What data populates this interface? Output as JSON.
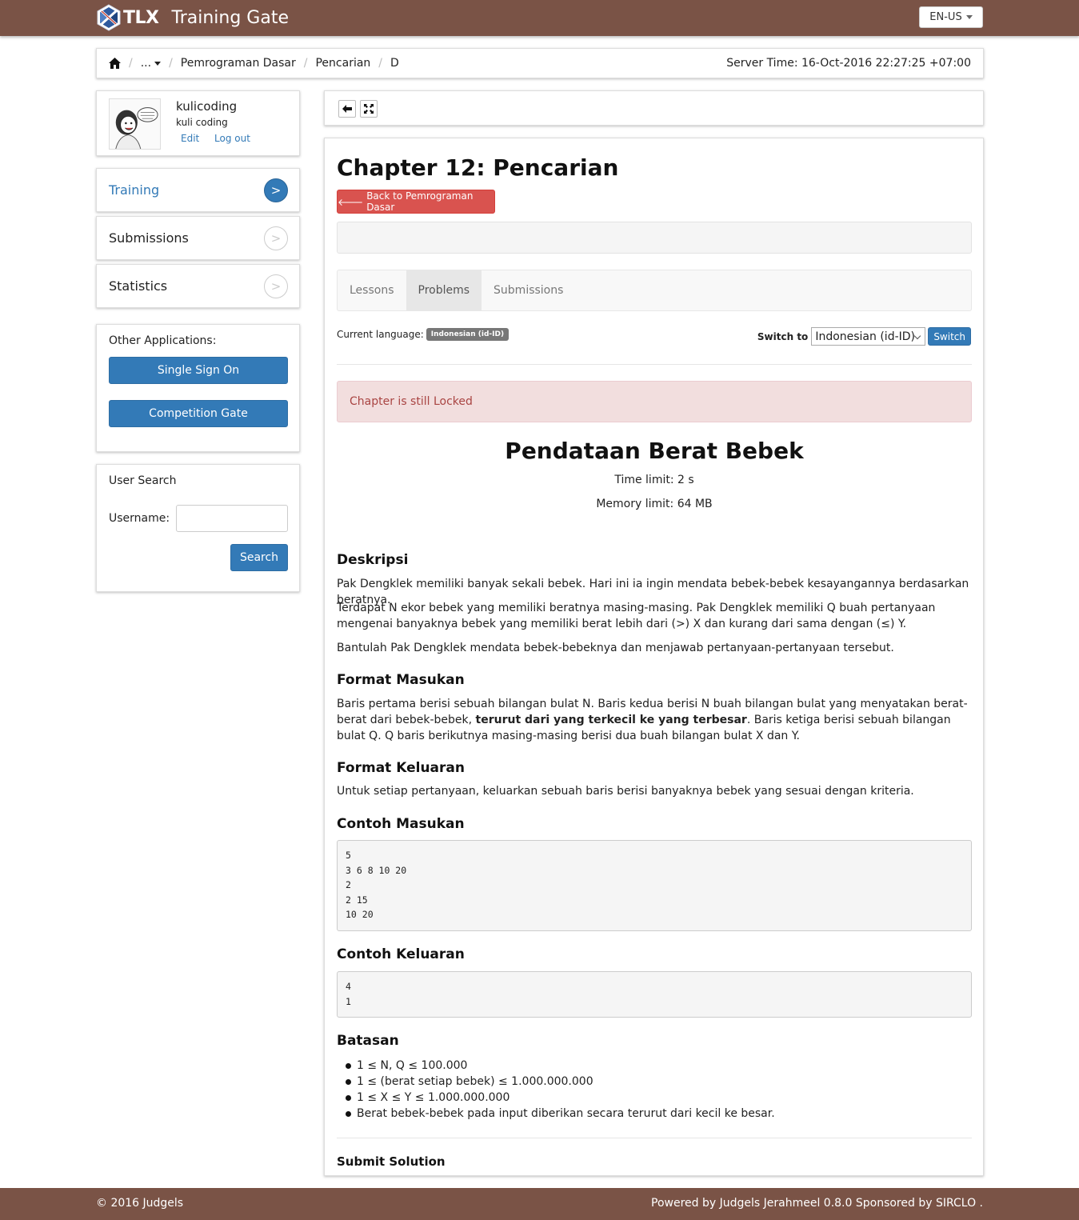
{
  "header": {
    "logo_text": "TLX",
    "app_title": "Training Gate",
    "language": "EN-US"
  },
  "breadcrumb": {
    "items": [
      "...",
      "Pemrograman Dasar",
      "Pencarian",
      "D"
    ],
    "server_time": "Server Time: 16-Oct-2016 22:27:25 +07:00"
  },
  "user": {
    "username": "kulicoding",
    "display_name": "kuli coding",
    "edit_label": "Edit",
    "logout_label": "Log out"
  },
  "sidebar": {
    "nav": [
      {
        "label": "Training",
        "active": true
      },
      {
        "label": "Submissions",
        "active": false
      },
      {
        "label": "Statistics",
        "active": false
      }
    ],
    "nav_arrow": ">",
    "other_apps_title": "Other Applications:",
    "apps": [
      "Single Sign On",
      "Competition Gate"
    ],
    "user_search": {
      "title": "User Search",
      "username_label": "Username:",
      "username_value": "",
      "button": "Search"
    }
  },
  "chapter": {
    "title": "Chapter 12: Pencarian",
    "back_button": "Back to Pemrograman Dasar",
    "tabs": [
      "Lessons",
      "Problems",
      "Submissions"
    ],
    "active_tab": "Problems",
    "current_language_label": "Current language:",
    "current_language": "Indonesian (id-ID)",
    "switch_to_label": "Switch to",
    "switch_select_value": "Indonesian (id-ID)",
    "switch_button": "Switch",
    "alert": "Chapter is still Locked"
  },
  "problem": {
    "title": "Pendataan Berat Bebek",
    "time_limit": "Time limit: 2 s",
    "memory_limit": "Memory limit: 64 MB",
    "sections": {
      "deskripsi_title": "Deskripsi",
      "deskripsi_p1": "Pak Dengklek memiliki banyak sekali bebek. Hari ini ia ingin mendata bebek-bebek kesayangannya berdasarkan beratnya.",
      "deskripsi_p2": "Terdapat N ekor bebek yang memiliki beratnya masing-masing. Pak Dengklek memiliki Q buah pertanyaan mengenai banyaknya bebek yang memiliki berat lebih dari (>) X dan kurang dari sama dengan (≤) Y.",
      "deskripsi_p3": "Bantulah Pak Dengklek mendata bebek-bebeknya dan menjawab pertanyaan-pertanyaan tersebut.",
      "masukan_title": "Format Masukan",
      "masukan_p_before": "Baris pertama berisi sebuah bilangan bulat N. Baris kedua berisi N buah bilangan bulat yang menyatakan berat-berat dari bebek-bebek, ",
      "masukan_p_bold": "terurut dari yang terkecil ke yang terbesar",
      "masukan_p_after": ". Baris ketiga berisi sebuah bilangan bulat Q. Q baris berikutnya masing-masing berisi dua buah bilangan bulat X dan Y.",
      "keluaran_title": "Format Keluaran",
      "keluaran_p": "Untuk setiap pertanyaan, keluarkan sebuah baris berisi banyaknya bebek yang sesuai dengan kriteria.",
      "contoh_masukan_title": "Contoh Masukan",
      "contoh_masukan": [
        "5",
        "3 6 8 10 20",
        "2",
        "2 15",
        "10 20"
      ],
      "contoh_keluaran_title": "Contoh Keluaran",
      "contoh_keluaran": [
        "4",
        "1"
      ],
      "batasan_title": "Batasan",
      "batasan": [
        "1 ≤ N, Q ≤ 100.000",
        "1 ≤ (berat setiap bebek) ≤ 1.000.000.000",
        "1 ≤ X ≤ Y ≤ 1.000.000.000",
        "Berat bebek-bebek pada input diberikan secara terurut dari kecil ke besar."
      ],
      "submit_title": "Submit Solution"
    }
  },
  "footer": {
    "left": "© 2016 Judgels",
    "right": "Powered by Judgels Jerahmeel 0.8.0 Sponsored by SIRCLO ."
  },
  "colors": {
    "header_bg": "#7a5346",
    "primary": "#337ab7",
    "danger": "#d9534f",
    "alert_bg": "#f2dede",
    "alert_text": "#a94442"
  },
  "icons": [
    "home-icon",
    "back-arrow-icon",
    "fullscreen-icon",
    "tlx-logo-icon"
  ]
}
